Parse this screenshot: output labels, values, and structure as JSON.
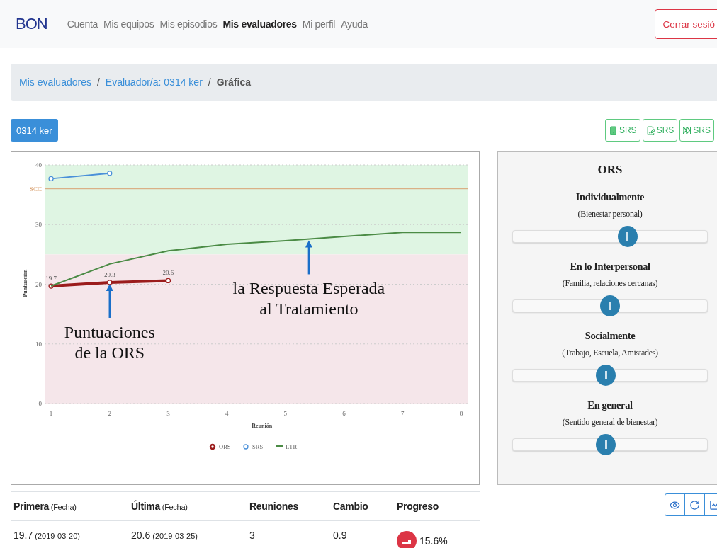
{
  "nav": {
    "logo": "BON",
    "links": [
      {
        "label": "Cuenta",
        "selected": false
      },
      {
        "label": "Mis equipos",
        "selected": false
      },
      {
        "label": "Mis episodios",
        "selected": false
      },
      {
        "label": "Mis evaluadores",
        "selected": true
      },
      {
        "label": "Mi perfil",
        "selected": false
      },
      {
        "label": "Ayuda",
        "selected": false
      }
    ],
    "logout": "Cerrar sesió"
  },
  "breadcrumb": {
    "separator": "/",
    "items": [
      {
        "label": "Mis evaluadores",
        "kind": "link"
      },
      {
        "label": "Evaluador/a: 0314 ker",
        "kind": "link"
      },
      {
        "label": "Gráfica",
        "kind": "current"
      }
    ]
  },
  "client_button": "0314 ker",
  "srs_buttons": [
    {
      "kind": "tablet",
      "label": "SRS"
    },
    {
      "kind": "form",
      "label": "SRS"
    },
    {
      "kind": "skip",
      "label": "SRS"
    }
  ],
  "chart": {
    "chart_data": {
      "type": "line",
      "xlabel": "Reunión",
      "ylabel": "Puntuación",
      "x": [
        1,
        2,
        3,
        4,
        5,
        6,
        7,
        8
      ],
      "xlim": [
        0.89,
        8.11
      ],
      "ylim": [
        0,
        40
      ],
      "xticks": [
        1,
        2,
        3,
        4,
        5,
        6,
        7,
        8
      ],
      "yticks": [
        0,
        10,
        20,
        30,
        40
      ],
      "grid": true,
      "legend": true,
      "bands": [
        {
          "axis": "y",
          "from": 25,
          "to": 40,
          "color": "#dff5e3"
        },
        {
          "axis": "y",
          "from": 0,
          "to": 25,
          "color": "#f5e6ea"
        }
      ],
      "ref_lines": [
        {
          "axis": "y",
          "value": 36,
          "label": "SCC",
          "color": "#d9a070"
        }
      ],
      "series": [
        {
          "name": "ORS",
          "color": "#9b1c1c",
          "marker": "circle",
          "values": [
            19.7,
            20.3,
            20.6,
            null,
            null,
            null,
            null,
            null
          ]
        },
        {
          "name": "SRS",
          "color": "#4a90d9",
          "marker": "circle",
          "values": [
            37.7,
            38.6,
            null,
            null,
            null,
            null,
            null,
            null
          ]
        },
        {
          "name": "ETR",
          "color": "#4b8b45",
          "values": [
            19.7,
            23.4,
            25.6,
            26.7,
            27.3,
            28,
            28.7,
            28.7
          ]
        }
      ],
      "annotations": [
        {
          "x": 1,
          "y": 19.7,
          "text": "19.7"
        },
        {
          "x": 2,
          "y": 20.3,
          "text": "20.3"
        },
        {
          "x": 3,
          "y": 20.6,
          "text": "20.6"
        },
        {
          "x": 2,
          "y": 20.3,
          "text": "Puntuaciones\nde la ORS"
        },
        {
          "x": 5.4,
          "y": 27.6,
          "text": "la Respuesta Esperada\nal Tratamiento"
        }
      ]
    }
  },
  "ors_panel": {
    "title": "ORS",
    "scales": [
      {
        "title": "Individualmente",
        "subtitle": "(Bienestar personal)",
        "level": 0.59
      },
      {
        "title": "En lo Interpersonal",
        "subtitle": "(Familia, relaciones cercanas)",
        "level": 0.5
      },
      {
        "title": "Socialmente",
        "subtitle": "(Trabajo, Escuela, Amistades)",
        "level": 0.48
      },
      {
        "title": "En general",
        "subtitle": "(Sentido general de bienestar)",
        "level": 0.48
      }
    ]
  },
  "tool_buttons": [
    {
      "kind": "view"
    },
    {
      "kind": "reload"
    },
    {
      "kind": "chart"
    }
  ],
  "summary": {
    "columns": [
      {
        "label": "Primera",
        "note": "(Fecha)"
      },
      {
        "label": "Última",
        "note": "(Fecha)"
      },
      {
        "label": "Reuniones"
      },
      {
        "label": "Cambio"
      },
      {
        "label": "Progreso"
      }
    ],
    "row": [
      {
        "kind": "text",
        "value": "19.7",
        "note": "(2019-03-20)"
      },
      {
        "kind": "text",
        "value": "20.6",
        "note": "(2019-03-25)"
      },
      {
        "kind": "text",
        "value": "3"
      },
      {
        "kind": "text",
        "value": "0.9"
      },
      {
        "kind": "progress",
        "value": "15.6%"
      }
    ]
  }
}
